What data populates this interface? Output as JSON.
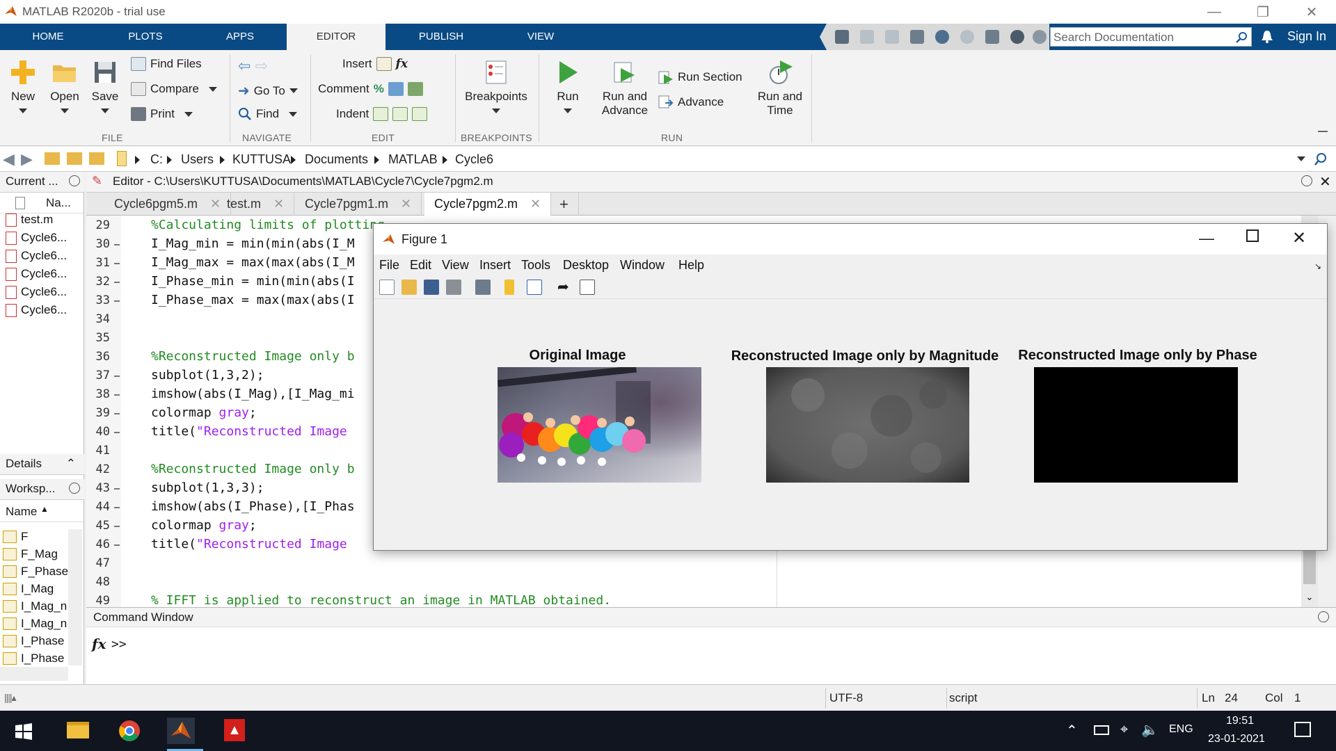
{
  "window": {
    "title": "MATLAB R2020b - trial use"
  },
  "ribbon_tabs": [
    "HOME",
    "PLOTS",
    "APPS",
    "EDITOR",
    "PUBLISH",
    "VIEW"
  ],
  "active_tab": "EDITOR",
  "search": {
    "placeholder": "Search Documentation"
  },
  "signin": "Sign In",
  "ribbon": {
    "file": {
      "new": "New",
      "open": "Open",
      "save": "Save",
      "find_files": "Find Files",
      "compare": "Compare",
      "print": "Print",
      "group": "FILE"
    },
    "navigate": {
      "goto": "Go To",
      "find": "Find",
      "group": "NAVIGATE"
    },
    "edit": {
      "insert": "Insert",
      "comment": "Comment",
      "indent": "Indent",
      "group": "EDIT"
    },
    "breakpoints": {
      "label": "Breakpoints",
      "group": "BREAKPOINTS"
    },
    "run": {
      "run": "Run",
      "run_advance_1": "Run and",
      "run_advance_2": "Advance",
      "run_section": "Run Section",
      "advance": "Advance",
      "run_time_1": "Run and",
      "run_time_2": "Time",
      "group": "RUN"
    }
  },
  "address": [
    "C:",
    "Users",
    "KUTTUSA",
    "Documents",
    "MATLAB",
    "Cycle6"
  ],
  "current_folder": {
    "title": "Current ...",
    "col": "Na...",
    "files": [
      "test.m",
      "Cycle6...",
      "Cycle6...",
      "Cycle6...",
      "Cycle6...",
      "Cycle6..."
    ]
  },
  "details": "Details",
  "workspace": {
    "title": "Worksp...",
    "col": "Name",
    "vars": [
      "F",
      "F_Mag",
      "F_Phase",
      "I_Mag",
      "I_Mag_n",
      "I_Mag_n",
      "I_Phase",
      "I_Phase"
    ]
  },
  "editor": {
    "path": "Editor - C:\\Users\\KUTTUSA\\Documents\\MATLAB\\Cycle7\\Cycle7pgm2.m",
    "tabs": [
      "Cycle6pgm5.m",
      "test.m",
      "Cycle7pgm1.m",
      "Cycle7pgm2.m"
    ],
    "active_tab": "Cycle7pgm2.m",
    "lines": [
      {
        "n": "29",
        "t": "%Calculating limits of plotting",
        "k": "cm",
        "d": false
      },
      {
        "n": "30",
        "t": "I_Mag_min = min(min(abs(I_M",
        "k": "",
        "d": true
      },
      {
        "n": "31",
        "t": "I_Mag_max = max(max(abs(I_M",
        "k": "",
        "d": true
      },
      {
        "n": "32",
        "t": "I_Phase_min = min(min(abs(I",
        "k": "",
        "d": true
      },
      {
        "n": "33",
        "t": "I_Phase_max = max(max(abs(I",
        "k": "",
        "d": true
      },
      {
        "n": "34",
        "t": "",
        "k": "",
        "d": false
      },
      {
        "n": "35",
        "t": "",
        "k": "",
        "d": false
      },
      {
        "n": "36",
        "t": "%Reconstructed Image only b",
        "k": "cm",
        "d": false
      },
      {
        "n": "37",
        "t": "subplot(1,3,2);",
        "k": "",
        "d": true
      },
      {
        "n": "38",
        "t": "imshow(abs(I_Mag),[I_Mag_mi",
        "k": "",
        "d": true
      },
      {
        "n": "39",
        "t": "colormap ",
        "k": "",
        "s": "gray",
        "e": ";",
        "d": true
      },
      {
        "n": "40",
        "t": "title(",
        "k": "",
        "s": "\"Reconstructed Image",
        "e": "",
        "d": true
      },
      {
        "n": "41",
        "t": "",
        "k": "",
        "d": false
      },
      {
        "n": "42",
        "t": "%Reconstructed Image only b",
        "k": "cm",
        "d": false
      },
      {
        "n": "43",
        "t": "subplot(1,3,3);",
        "k": "",
        "d": true
      },
      {
        "n": "44",
        "t": "imshow(abs(I_Phase),[I_Phas",
        "k": "",
        "d": true
      },
      {
        "n": "45",
        "t": "colormap ",
        "k": "",
        "s": "gray",
        "e": ";",
        "d": true
      },
      {
        "n": "46",
        "t": "title(",
        "k": "",
        "s": "\"Reconstructed Image",
        "e": "",
        "d": true
      },
      {
        "n": "47",
        "t": "",
        "k": "",
        "d": false
      },
      {
        "n": "48",
        "t": "",
        "k": "",
        "d": false
      },
      {
        "n": "49",
        "t": "% IFFT is applied to reconstruct an image in MATLAB obtained.",
        "k": "cm",
        "d": false
      }
    ]
  },
  "command_window": {
    "title": "Command Window",
    "prompt": ">>"
  },
  "status": {
    "encoding": "UTF-8",
    "type": "script",
    "ln_label": "Ln",
    "ln": "24",
    "col_label": "Col",
    "col": "1"
  },
  "figure": {
    "title": "Figure 1",
    "menu": [
      "File",
      "Edit",
      "View",
      "Insert",
      "Tools",
      "Desktop",
      "Window",
      "Help"
    ],
    "plots": [
      "Original Image",
      "Reconstructed Image only by Magnitude",
      "Reconstructed Image only by Phase"
    ]
  },
  "taskbar": {
    "lang": "ENG",
    "time": "19:51",
    "date": "23-01-2021"
  },
  "colors": {
    "ribbon_tab_bar": "#0a4a84",
    "comment": "#228b22",
    "string": "#a020f0",
    "taskbar": "#101520"
  }
}
